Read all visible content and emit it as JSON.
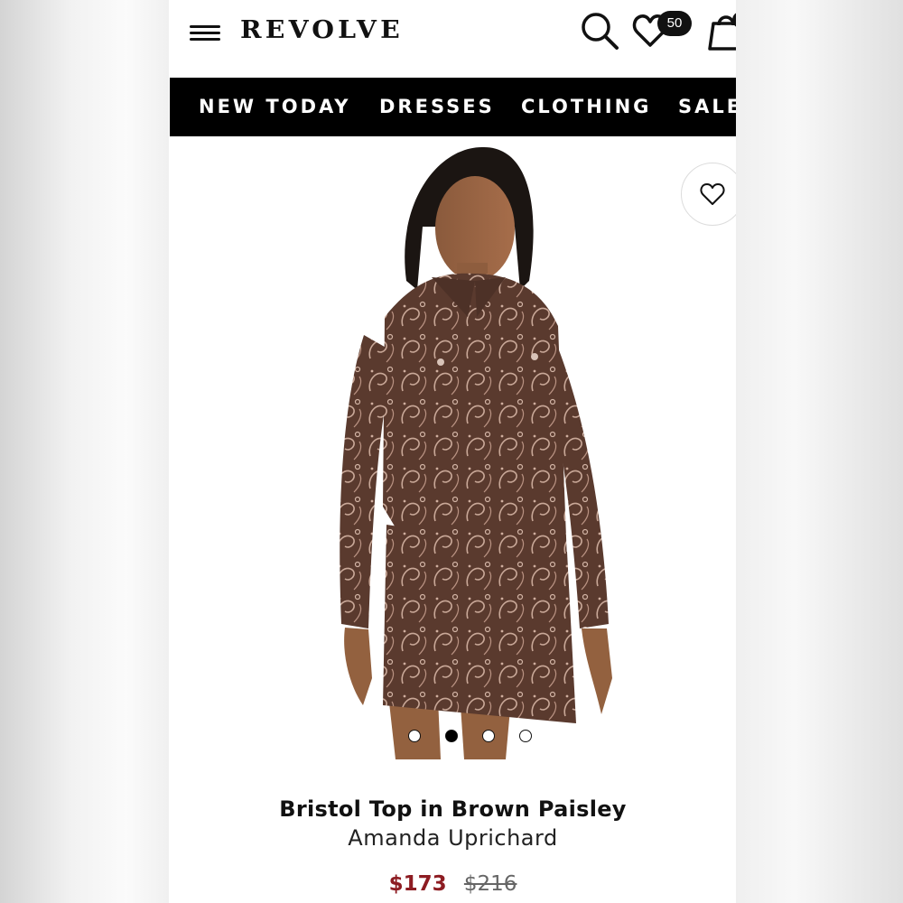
{
  "header": {
    "logo": "REVOLVE",
    "favorites_count": "50",
    "icons": [
      "hamburger-menu-icon",
      "search-icon",
      "heart-icon",
      "shopping-bag-icon"
    ]
  },
  "nav": {
    "items": [
      "NEW TODAY",
      "DRESSES",
      "CLOTHING",
      "SALE"
    ]
  },
  "product": {
    "image_description_icon": "product-photo",
    "title": "Bristol Top in Brown Paisley",
    "brand": "Amanda Uprichard",
    "sale_price": "$173",
    "original_price": "$216",
    "carousel": {
      "total": 4,
      "active_index": 1
    }
  },
  "colors": {
    "accent_sale": "#8d1c22",
    "nav_bg": "#000000",
    "fabric_brown": "#5a3a2e"
  }
}
